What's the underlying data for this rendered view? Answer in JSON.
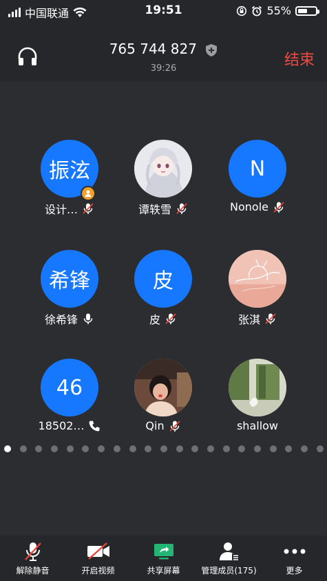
{
  "status_bar": {
    "carrier": "中国联通",
    "time": "19:51",
    "battery": "55%"
  },
  "header": {
    "meeting_id": "765 744 827",
    "duration": "39:26",
    "end_label": "结束"
  },
  "participants": [
    {
      "avatar_text": "振泫",
      "name": "设计…",
      "avatar_type": "text",
      "status": "muted",
      "is_host": true
    },
    {
      "avatar_text": "",
      "name": "谭轶雪",
      "avatar_type": "image",
      "status": "muted",
      "is_host": false
    },
    {
      "avatar_text": "N",
      "name": "Nonole",
      "avatar_type": "text",
      "status": "muted",
      "is_host": false
    },
    {
      "avatar_text": "希锋",
      "name": "徐希锋",
      "avatar_type": "text",
      "status": "mic-on",
      "is_host": false
    },
    {
      "avatar_text": "皮",
      "name": "皮",
      "avatar_type": "text",
      "status": "muted",
      "is_host": false
    },
    {
      "avatar_text": "",
      "name": "张淇",
      "avatar_type": "image",
      "status": "muted",
      "is_host": false
    },
    {
      "avatar_text": "46",
      "name": "18502…",
      "avatar_type": "text",
      "status": "phone",
      "is_host": false
    },
    {
      "avatar_text": "",
      "name": "Qin",
      "avatar_type": "image",
      "status": "muted",
      "is_host": false
    },
    {
      "avatar_text": "",
      "name": "shallow",
      "avatar_type": "image",
      "status": "none",
      "is_host": false
    }
  ],
  "pager": {
    "total": 21,
    "active": 0
  },
  "toolbar": {
    "unmute": "解除静音",
    "video": "开启视频",
    "share": "共享屏幕",
    "members": "管理成员(175)",
    "more": "更多"
  },
  "colors": {
    "accent": "#1677ff",
    "end": "#ec4a43",
    "share_green": "#22b573",
    "mute_red": "#e8453c"
  }
}
